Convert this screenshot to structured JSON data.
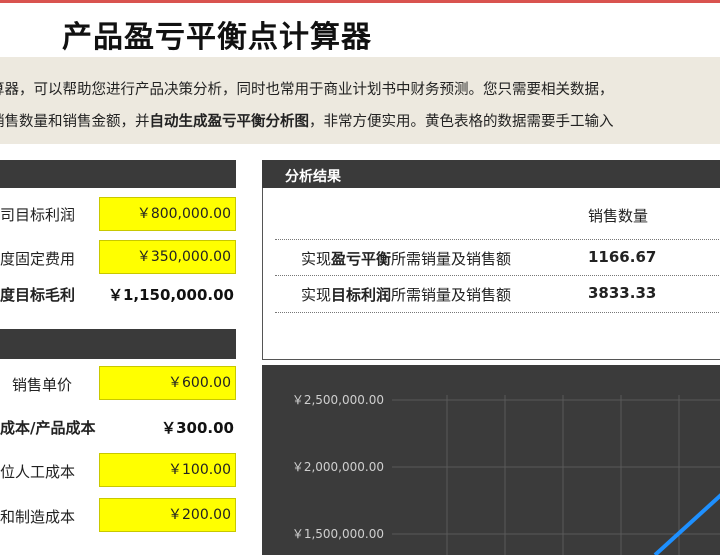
{
  "title": "产品盈亏平衡点计算器",
  "intro": {
    "line1": "算器，可以帮助您进行产品决策分析，同时也常用于商业计划书中财务预测。您只需要相关数据，",
    "line2_a": "销售数量和销售金额，并",
    "line2_b": "自动生成盈亏平衡分析图",
    "line2_c": "，非常方便实用。黄色表格的数据需要手工输入"
  },
  "left": {
    "rows1": [
      {
        "label": "司目标利润",
        "value": "￥800,000.00"
      },
      {
        "label": "度固定费用",
        "value": "￥350,000.00"
      },
      {
        "label": "度目标毛利",
        "value": "￥1,150,000.00"
      }
    ],
    "rows2": [
      {
        "label": "销售单价",
        "value": "￥600.00"
      },
      {
        "label": "成本/产品成本",
        "value": "￥300.00"
      },
      {
        "label": "位人工成本",
        "value": "￥100.00"
      },
      {
        "label": "和制造成本",
        "value": "￥200.00"
      }
    ]
  },
  "results": {
    "title": "分析结果",
    "col_header": "销售数量",
    "row1": {
      "pre": "实现",
      "bold": "盈亏平衡",
      "post": "所需销量及销售额",
      "qty": "1166.67"
    },
    "row2": {
      "pre": "实现",
      "bold": "目标利润",
      "post": "所需销量及销售额",
      "qty": "3833.33"
    }
  },
  "chart_data": {
    "type": "line",
    "y_ticks": [
      "￥2,500,000.00",
      "￥2,000,000.00",
      "￥1,500,000.00"
    ],
    "grid": true,
    "series_color": "#1e90ff"
  },
  "colors": {
    "input_fill": "#ffff00",
    "panel_header": "#3a3a3a",
    "chart_bg": "#3b3b3b"
  }
}
